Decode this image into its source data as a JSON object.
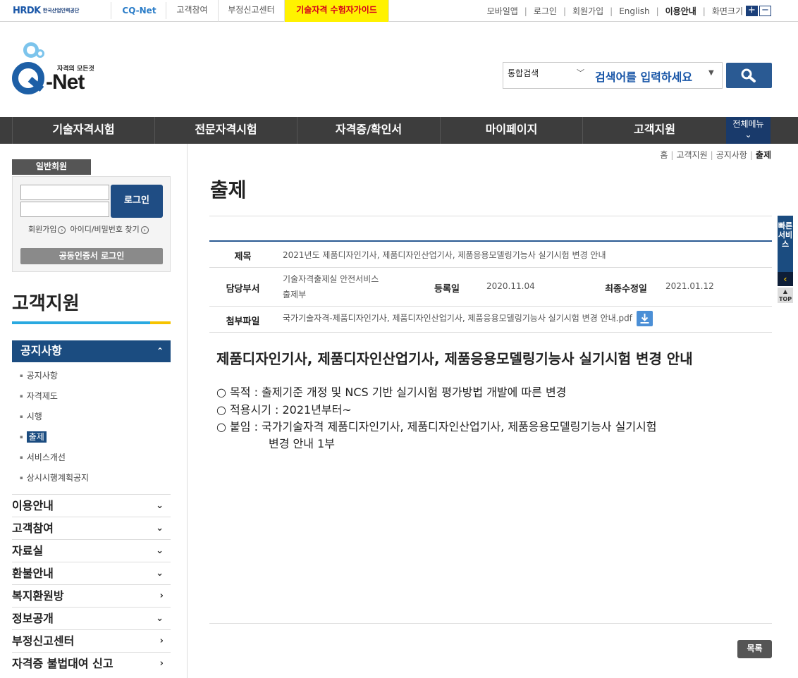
{
  "topbar": {
    "hrdk_logo": "HRDK",
    "hrdk_org": "한국산업인력공단",
    "cqnet_logo": "CQ-Net",
    "links": [
      "고객참여",
      "부정신고센터",
      "기술자격 수험자가이드"
    ],
    "util": [
      "모바일앱",
      "로그인",
      "회원가입",
      "English",
      "이용안내",
      "화면크기"
    ],
    "zoom_in": "+",
    "zoom_out": "−"
  },
  "brand": {
    "slogan": "자격의 모든것",
    "name": "-Net"
  },
  "search": {
    "scope": "통합검색",
    "placeholder": "검색어를 입력하세요"
  },
  "gnb": [
    "기술자격시험",
    "전문자격시험",
    "자격증/확인서",
    "마이페이지",
    "고객지원"
  ],
  "allmenu_label": "전체메뉴",
  "login": {
    "tab": "일반회원",
    "button": "로그인",
    "join": "회원가입",
    "find": "아이디/비밀번호 찾기",
    "cert": "공동인증서 로그인"
  },
  "lnb": {
    "title": "고객지원",
    "active": "공지사항",
    "subs": [
      "공지사항",
      "자격제도",
      "시행",
      "출제",
      "서비스개선",
      "상시시행계획공지"
    ],
    "menus": [
      {
        "label": "이용안내",
        "icon": "chevron-down"
      },
      {
        "label": "고객참여",
        "icon": "chevron-down"
      },
      {
        "label": "자료실",
        "icon": "chevron-down"
      },
      {
        "label": "환불안내",
        "icon": "chevron-down"
      },
      {
        "label": "복지환원방",
        "icon": "chevron-right"
      },
      {
        "label": "정보공개",
        "icon": "chevron-down"
      },
      {
        "label": "부정신고센터",
        "icon": "chevron-right"
      },
      {
        "label": "자격증 불법대여 신고",
        "icon": "chevron-right"
      }
    ]
  },
  "breadcrumb": [
    "홈",
    "고객지원",
    "공지사항",
    "출제"
  ],
  "page_title": "출제",
  "notice": {
    "subject_label": "제목",
    "subject": "2021년도 제품디자인기사, 제품디자인산업기사, 제품응용모델링기능사 실기시험 변경 안내",
    "dept_label": "담당부서",
    "dept_line1": "기술자격출제실 안전서비스",
    "dept_line2": "출제부",
    "reg_label": "등록일",
    "reg_date": "2020.11.04",
    "mod_label": "최종수정일",
    "mod_date": "2021.01.12",
    "attach_label": "첨부파일",
    "attach": "국가기술자격-제품디자인기사, 제품디자인산업기사, 제품응용모델링기능사 실기시험 변경 안내.pdf"
  },
  "article": {
    "title": "제품디자인기사, 제품디자인산업기사, 제품응용모델링기능사 실기시험 변경 안내",
    "lines": [
      "○ 목적 : 출제기준 개정 및 NCS 기반 실기시험 평가방법 개발에 따른 변경",
      "○ 적용시기 : 2021년부터~",
      "○ 붙임 : 국가기술자격 제품디자인기사, 제품디자인산업기사, 제품응용모델링기능사 실기시험",
      "변경 안내 1부"
    ]
  },
  "list_button": "목록",
  "quick": {
    "label": "빠른서비스",
    "top": "TOP"
  }
}
